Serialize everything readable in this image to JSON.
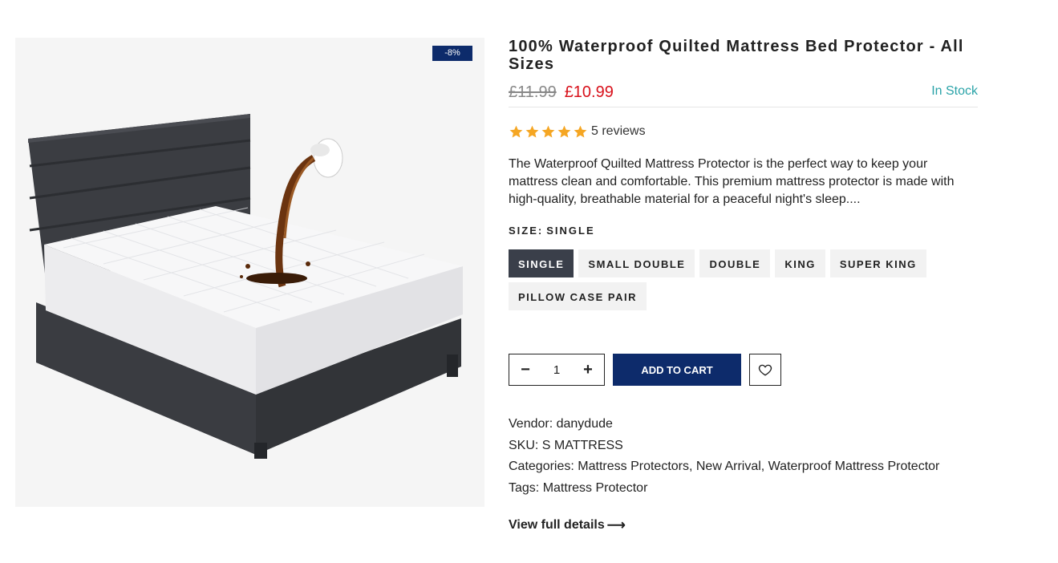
{
  "badge": {
    "discount": "-8%"
  },
  "product": {
    "title": "100% Waterproof Quilted Mattress Bed Protector - All Sizes",
    "price_old": "£11.99",
    "price_new": "£10.99",
    "stock": "In Stock",
    "rating": 5,
    "reviews": "5 reviews",
    "description": "The Waterproof Quilted Mattress Protector is the perfect way to keep your mattress clean and comfortable. This premium mattress protector is made with high-quality, breathable material for a peaceful night's sleep....",
    "size_label": "SIZE:",
    "size_selected": "SINGLE",
    "sizes": [
      "SINGLE",
      "SMALL DOUBLE",
      "DOUBLE",
      "KING",
      "SUPER KING",
      "PILLOW CASE PAIR"
    ],
    "quantity": "1",
    "qty_minus": "−",
    "qty_plus": "+",
    "add_to_cart": "ADD TO CART",
    "vendor_label": "Vendor:",
    "vendor": "danydude",
    "sku_label": "SKU:",
    "sku": "S MATTRESS",
    "categories_label": "Categories:",
    "categories": [
      "Mattress Protectors",
      "New Arrival",
      "Waterproof Mattress Protector"
    ],
    "tags_label": "Tags:",
    "tags": [
      "Mattress Protector"
    ],
    "view_full": "View full details",
    "view_full_arrow": "⟶"
  },
  "colors": {
    "brand_blue": "#0d2b6b",
    "sale_red": "#d8101a",
    "stock_teal": "#2aa3a8",
    "star_gold": "#f5a623",
    "swatch_active": "#3a3f4a"
  },
  "icons": {
    "rating": "star-icon",
    "wishlist": "heart-icon",
    "arrow": "arrow-right-icon"
  }
}
